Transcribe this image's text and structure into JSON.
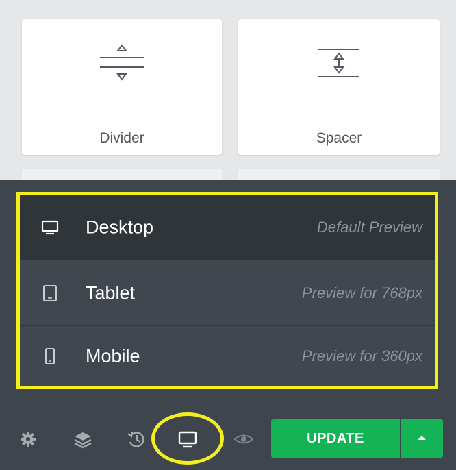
{
  "widgets": [
    {
      "label": "Divider",
      "icon": "divider-icon"
    },
    {
      "label": "Spacer",
      "icon": "spacer-icon"
    }
  ],
  "device_menu": {
    "items": [
      {
        "label": "Desktop",
        "hint": "Default Preview",
        "icon": "desktop-icon",
        "active": true
      },
      {
        "label": "Tablet",
        "hint": "Preview for 768px",
        "icon": "tablet-icon",
        "active": false
      },
      {
        "label": "Mobile",
        "hint": "Preview for 360px",
        "icon": "mobile-icon",
        "active": false
      }
    ]
  },
  "toolbar": {
    "icons": [
      "gear-icon",
      "layers-icon",
      "history-icon",
      "desktop-icon",
      "eye-icon"
    ],
    "update_label": "UPDATE",
    "caret_icon": "caret-up-icon"
  },
  "colors": {
    "panel": "#3e454c",
    "active_item": "#30353a",
    "highlight": "#f3ee1d",
    "update_button": "#13b356"
  }
}
